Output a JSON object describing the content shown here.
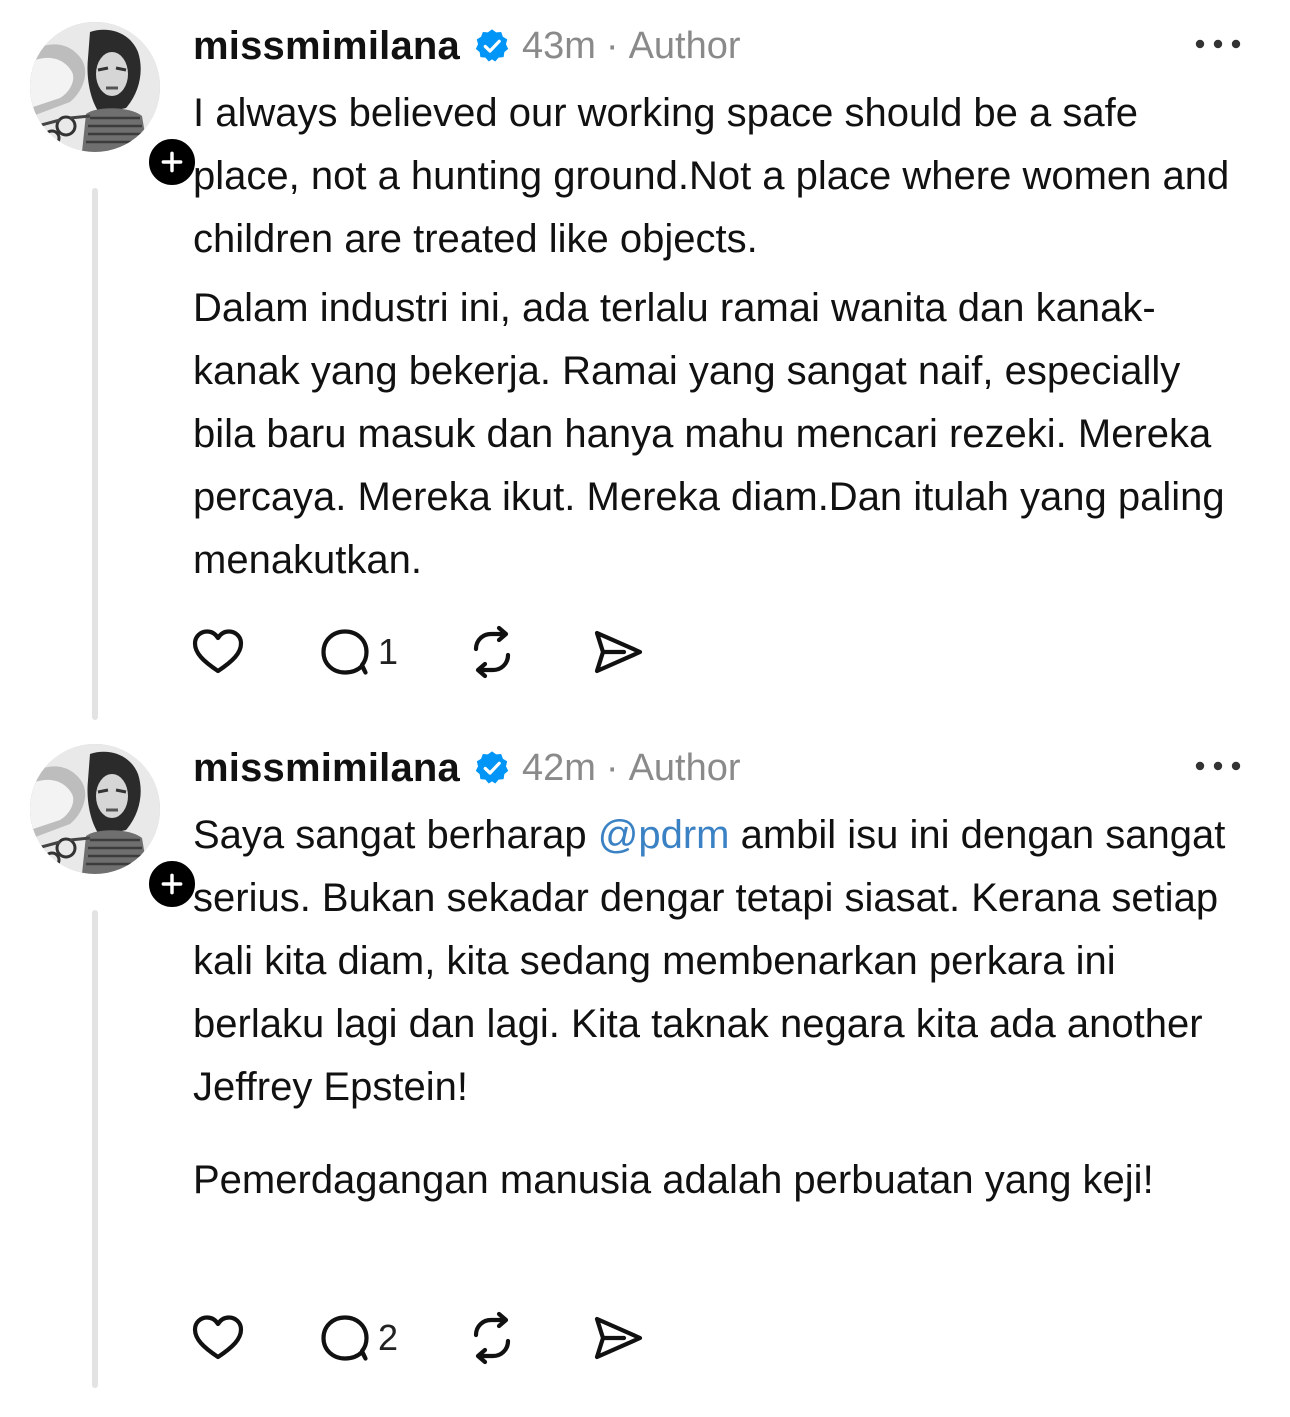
{
  "posts": [
    {
      "username": "missmimilana",
      "verified": true,
      "time": "43m",
      "role": "Author",
      "paragraphs": [
        {
          "text": "I always believed our working space should be a safe place, not a hunting ground.Not a place where women and children are treated like objects."
        },
        {
          "text": "Dalam industri ini, ada terlalu ramai wanita dan kanak-kanak yang bekerja. Ramai yang sangat naif, especially bila baru masuk dan hanya mahu mencari rezeki. Mereka percaya. Mereka ikut. Mereka diam.Dan itulah yang paling menakutkan."
        }
      ],
      "reply_count": "1"
    },
    {
      "username": "missmimilana",
      "verified": true,
      "time": "42m",
      "role": "Author",
      "paragraphs": [
        {
          "before": "Saya sangat berharap ",
          "mention": "@pdrm",
          "after": " ambil isu ini dengan sangat serius. Bukan sekadar dengar tetapi siasat. Kerana setiap kali kita diam, kita sedang membenarkan perkara ini berlaku lagi dan lagi. Kita taknak negara kita ada another Jeffrey Epstein!"
        },
        {
          "text": "Pemerdagangan manusia adalah perbuatan yang keji!"
        }
      ],
      "reply_count": "2"
    }
  ],
  "meta_separator": "·",
  "icons": {
    "verified": "verified-badge-icon",
    "follow": "plus-icon",
    "more": "more-dots-icon",
    "like": "heart-icon",
    "reply": "comment-bubble-icon",
    "repost": "repost-icon",
    "share": "send-icon"
  },
  "colors": {
    "verified_blue": "#0095f6",
    "mention_blue": "#3b82c4",
    "meta_gray": "#8a8a8a"
  }
}
